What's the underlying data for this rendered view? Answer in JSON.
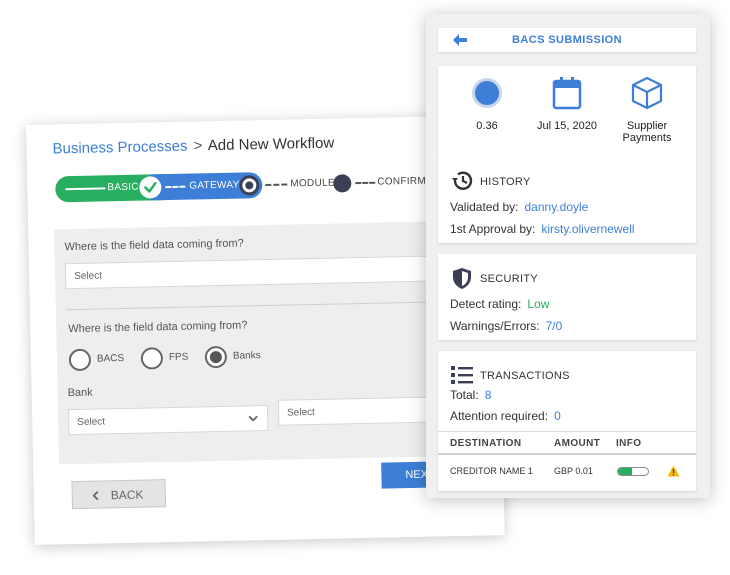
{
  "workflow": {
    "breadcrumb": "Business Processes",
    "separator": ">",
    "page_title": "Add New Workflow",
    "steps": [
      {
        "label": "BASIC",
        "state": "done"
      },
      {
        "label": "GATEWAYS",
        "state": "current"
      },
      {
        "label": "MODULE",
        "state": "upcoming"
      },
      {
        "label": "CONFIRMATI",
        "state": "upcoming"
      }
    ],
    "field1": {
      "label": "Where is the field data coming from?",
      "placeholder": "Select"
    },
    "field2": {
      "label": "Where is the field data coming from?",
      "options": [
        {
          "label": "BACS",
          "selected": false
        },
        {
          "label": "FPS",
          "selected": false
        },
        {
          "label": "Banks",
          "selected": true
        }
      ]
    },
    "bank": {
      "label": "Bank",
      "select1": "Select",
      "select2": "Select"
    },
    "back_label": "BACK",
    "next_label": "NEXT",
    "colors": {
      "success": "#27ae60",
      "accent": "#3d7fd6"
    }
  },
  "submission": {
    "title": "BACS SUBMISSION",
    "summary": {
      "value": "0.36",
      "date": "Jul 15, 2020",
      "type": "Supplier Payments"
    },
    "history": {
      "heading": "HISTORY",
      "validated_label": "Validated by:",
      "validated_value": "danny.doyle",
      "approval_label": "1st Approval by:",
      "approval_value": "kirsty.olivernewell"
    },
    "security": {
      "heading": "SECURITY",
      "detect_label": "Detect rating:",
      "detect_value": "Low",
      "warnings_label": "Warnings/Errors:",
      "warnings_value": "7/0"
    },
    "transactions": {
      "heading": "TRANSACTIONS",
      "total_label": "Total:",
      "total_value": "8",
      "attention_label": "Attention required:",
      "attention_value": "0",
      "columns": [
        "DESTINATION",
        "AMOUNT",
        "INFO"
      ],
      "rows": [
        {
          "destination": "CREDITOR NAME 1",
          "amount": "GBP 0.01",
          "progress": 0.45,
          "warning_icon": "warning-icon"
        }
      ]
    }
  }
}
